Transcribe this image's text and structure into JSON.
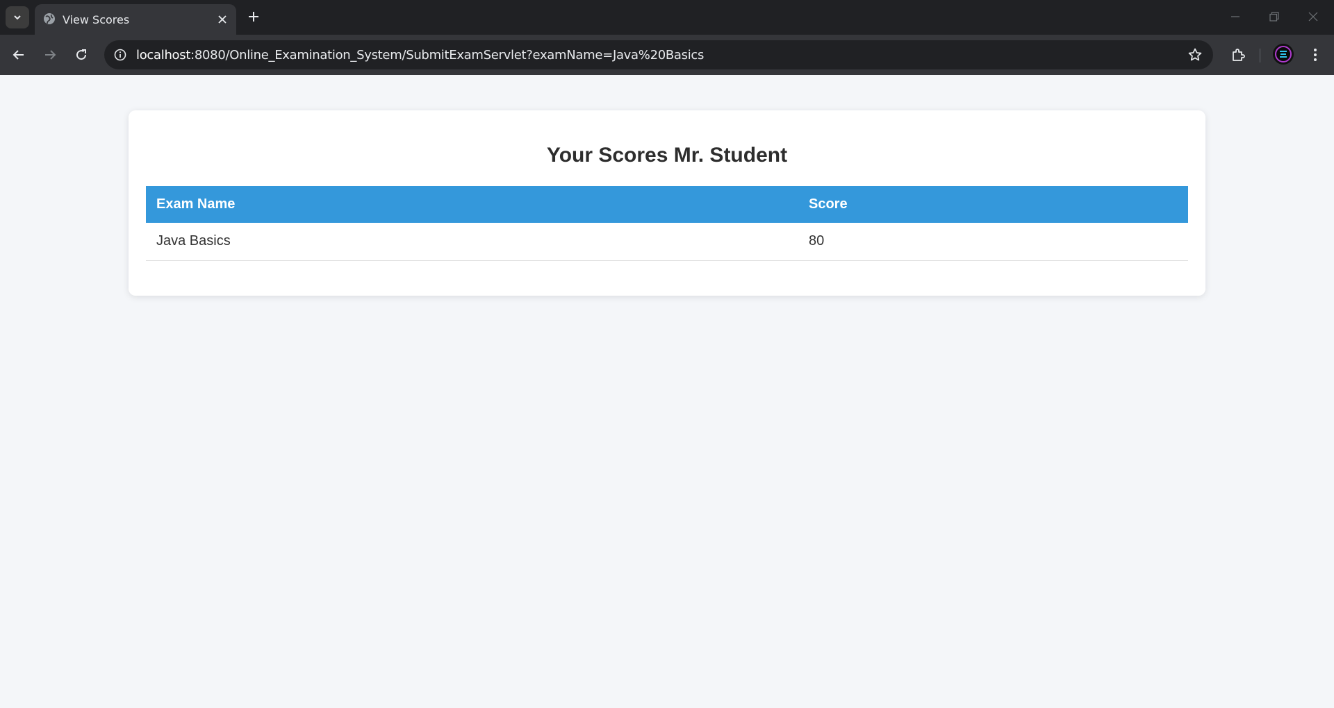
{
  "browser": {
    "tab": {
      "title": "View Scores",
      "favicon": "globe-icon"
    },
    "url": {
      "host": "localhost",
      "rest": ":8080/Online_Examination_System/SubmitExamServlet?examName=Java%20Basics"
    }
  },
  "page": {
    "title": "Your Scores Mr. Student",
    "table": {
      "headers": [
        "Exam Name",
        "Score"
      ],
      "rows": [
        {
          "exam_name": "Java Basics",
          "score": "80"
        }
      ]
    },
    "colors": {
      "header_bg": "#3498db",
      "background": "#f4f6f9"
    }
  }
}
